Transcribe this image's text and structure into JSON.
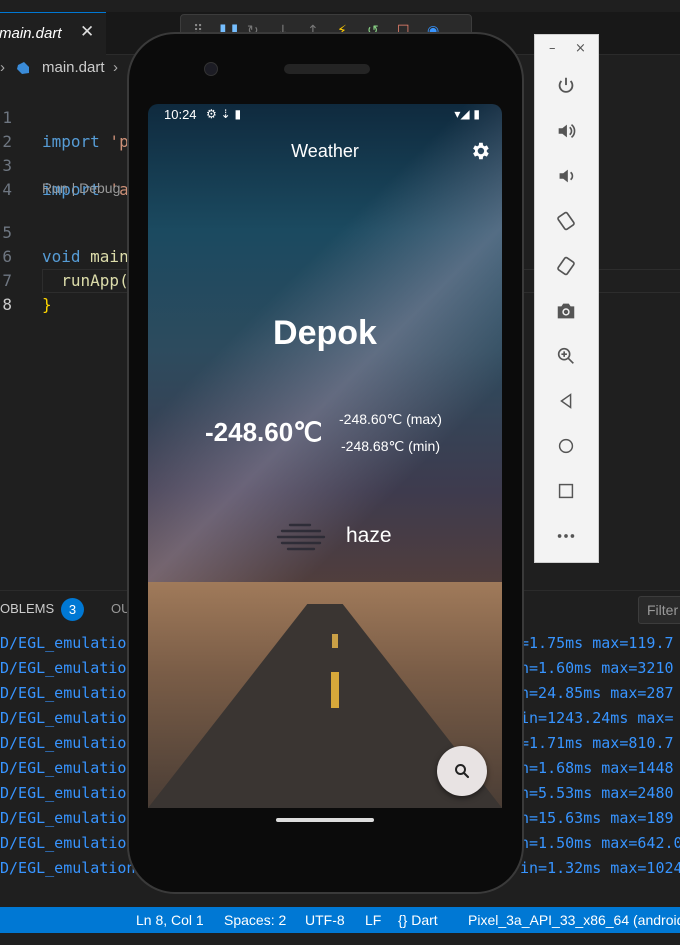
{
  "editor": {
    "tab_label": "main.dart",
    "tab_close": "✕",
    "breadcrumb_file": "main.dart",
    "codelens": "Run | Debug",
    "lines": [
      {
        "num": "1",
        "code_kw": "import",
        "code_rest": " 'p"
      },
      {
        "num": "2",
        "code_kw": "",
        "code_rest": ""
      },
      {
        "num": "3",
        "code_kw": "import",
        "code_rest": " 'a"
      },
      {
        "num": "4",
        "code_kw": "",
        "code_rest": ""
      },
      {
        "num": "5",
        "code_kw": "void",
        "code_rest": " main"
      },
      {
        "num": "6",
        "code_kw": "",
        "code_rest": "  runApp("
      },
      {
        "num": "7",
        "code_kw": "",
        "code_rest": "}"
      },
      {
        "num": "8",
        "code_kw": "",
        "code_rest": ""
      }
    ]
  },
  "panel": {
    "problems_label": "OBLEMS",
    "problems_count": "3",
    "output_label": "OU",
    "filter_placeholder": "Filter",
    "log_left": [
      "D/EGL_emulation",
      "D/EGL_emulation",
      "D/EGL_emulation",
      "D/EGL_emulation",
      "D/EGL_emulation",
      "D/EGL_emulation",
      "D/EGL_emulation",
      "D/EGL_emulation",
      "D/EGL_emulation",
      "D/EGL_emulation"
    ],
    "log_right": [
      "=1.75ms max=119.7",
      "n=1.60ms max=3210",
      "n=24.85ms max=287",
      "in=1243.24ms max=",
      "=1.71ms max=810.7",
      "n=1.68ms max=1448",
      "n=5.53ms max=2480",
      "n=15.63ms max=189",
      "n=1.50ms max=642.0",
      "in=1.32ms max=1024"
    ]
  },
  "statusbar": {
    "position": "Ln 8, Col 1",
    "spaces": "Spaces: 2",
    "encoding": "UTF-8",
    "eol": "LF",
    "language": "{} Dart",
    "device": "Pixel_3a_API_33_x86_64 (android"
  },
  "emulator_toolbar": {
    "minimize": "–",
    "close": "×",
    "buttons": [
      "power-icon",
      "volume-up-icon",
      "volume-down-icon",
      "rotate-left-icon",
      "rotate-right-icon",
      "camera-icon",
      "zoom-icon",
      "back-icon",
      "home-icon",
      "overview-icon",
      "more-icon"
    ]
  },
  "phone": {
    "status_time": "10:24",
    "app_title": "Weather",
    "city": "Depok",
    "temperature": "-248.60℃",
    "temp_max": "-248.60℃ (max)",
    "temp_min": "-248.68℃ (min)",
    "condition": "haze"
  },
  "colors": {
    "accent": "#0078d4",
    "keyword": "#569cd6",
    "log": "#3794ff",
    "fab": "#e8e3e3"
  }
}
